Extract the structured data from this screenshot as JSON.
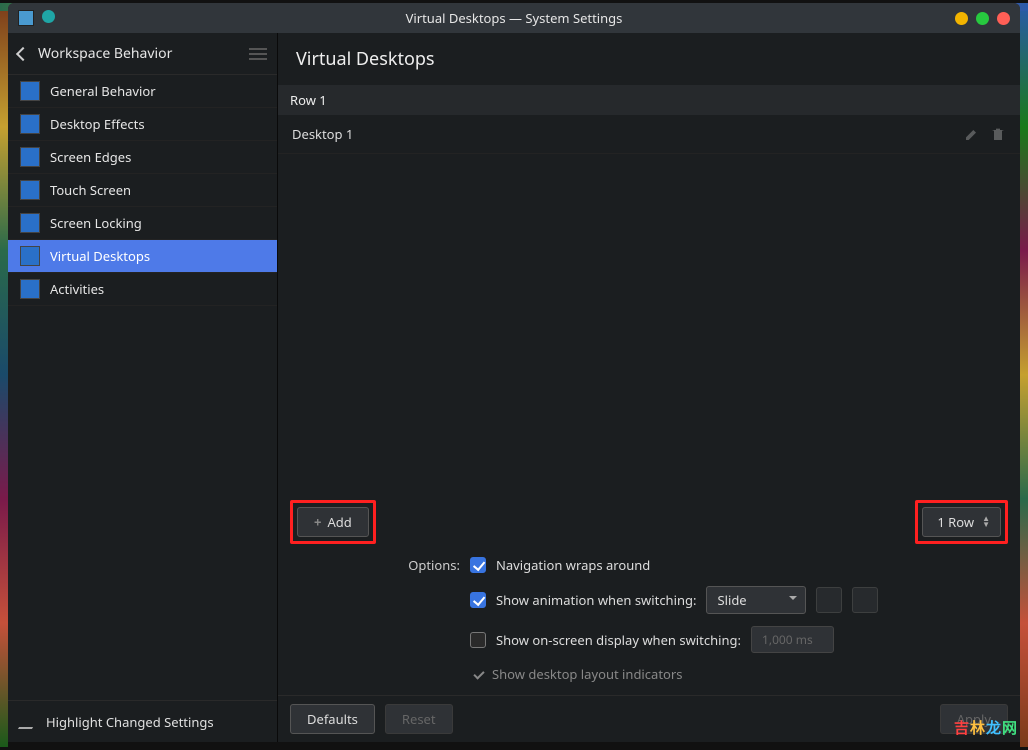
{
  "window": {
    "title": "Virtual Desktops — System Settings",
    "traffic_colors": {
      "min": "#f2b400",
      "max": "#27c93f",
      "close": "#ff5f56"
    }
  },
  "sidebar": {
    "title": "Workspace Behavior",
    "items": [
      {
        "label": "General Behavior",
        "active": false
      },
      {
        "label": "Desktop Effects",
        "active": false
      },
      {
        "label": "Screen Edges",
        "active": false
      },
      {
        "label": "Touch Screen",
        "active": false
      },
      {
        "label": "Screen Locking",
        "active": false
      },
      {
        "label": "Virtual Desktops",
        "active": true
      },
      {
        "label": "Activities",
        "active": false
      }
    ],
    "footer": "Highlight Changed Settings"
  },
  "page": {
    "title": "Virtual Desktops",
    "row_header": "Row 1",
    "desktops": [
      {
        "name": "Desktop 1"
      }
    ],
    "add_label": "Add",
    "row_spin_label": "1 Row"
  },
  "options": {
    "label": "Options:",
    "nav_wrap": {
      "checked": true,
      "label": "Navigation wraps around"
    },
    "show anim": {
      "checked": true,
      "label": "Show animation when switching:",
      "value": "Slide"
    },
    "osd": {
      "checked": false,
      "label": "Show on-screen display when switching:",
      "duration": "1,000 ms"
    },
    "layout_ind": "Show desktop layout indicators"
  },
  "footer": {
    "defaults": "Defaults",
    "reset": "Reset",
    "apply": "Apply"
  },
  "watermark": "吉林龙网"
}
